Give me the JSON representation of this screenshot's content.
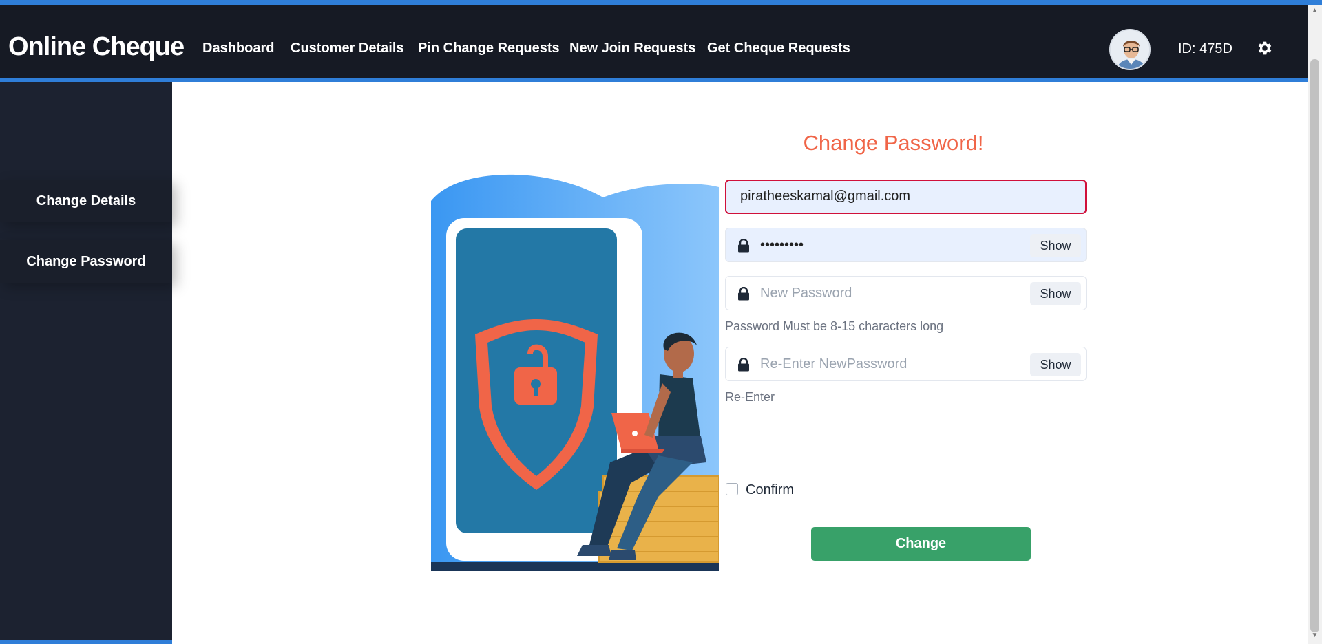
{
  "header": {
    "brand": "Online Cheque",
    "nav": [
      "Dashboard",
      "Customer Details",
      "Pin Change Requests",
      "New Join Requests",
      "Get Cheque Requests"
    ],
    "user_id": "ID: 475D"
  },
  "sidebar": {
    "items": [
      "Change Details",
      "Change Password"
    ]
  },
  "form": {
    "title": "Change Password!",
    "email_value": "piratheeskamal@gmail.com",
    "current_password_value": "•••••••••",
    "new_password_placeholder": "New Password",
    "new_password_hint": "Password Must be 8-15 characters long",
    "reenter_placeholder": "Re-Enter NewPassword",
    "reenter_hint": "Re-Enter",
    "show_label": "Show",
    "confirm_label": "Confirm",
    "submit_label": "Change"
  },
  "colors": {
    "accent": "#2f7ed8",
    "navbar": "#161a24",
    "sidebar": "#1c2230",
    "title": "#f06548",
    "submit": "#38a169",
    "email_border": "#d0103a"
  },
  "icons": {
    "settings": "gear-icon",
    "lock": "lock-icon"
  }
}
